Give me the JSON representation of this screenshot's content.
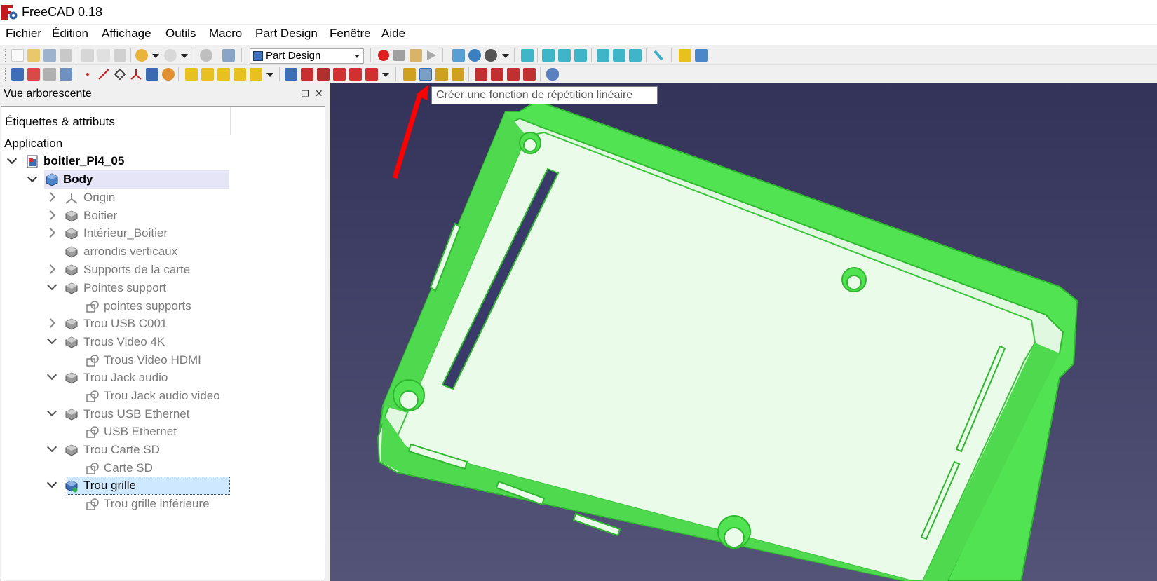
{
  "window": {
    "title": "FreeCAD 0.18"
  },
  "menu": [
    "Fichier",
    "Édition",
    "Affichage",
    "Outils",
    "Macro",
    "Part Design",
    "Fenêtre",
    "Aide"
  ],
  "workbench": {
    "selected": "Part Design"
  },
  "tooltip": "Créer une fonction de répétition linéaire",
  "panel": {
    "title": "Vue arborescente",
    "column_header": "Étiquettes & attributs",
    "root_label": "Application"
  },
  "tree": {
    "document": "boitier_Pi4_05",
    "body": "Body",
    "items": [
      "Origin",
      "Boitier",
      "Intérieur_Boitier",
      "arrondis verticaux",
      "Supports de la carte",
      "Pointes support",
      "pointes supports",
      "Trou USB C001",
      "Trous Video 4K",
      "Trous Video HDMI",
      "Trou Jack audio",
      "Trou Jack audio video",
      "Trous USB Ethernet",
      "USB Ethernet",
      "Trou Carte SD",
      "Carte SD",
      "Trou grille",
      "Trou grille inférieure"
    ]
  },
  "colors": {
    "model_green": "#52e352",
    "model_face": "#eafbea",
    "viewport_top": "#33335a",
    "viewport_bottom": "#545478",
    "selection": "#cde8ff",
    "arrow": "#ff0000"
  },
  "icons": [
    "freecad-logo-icon",
    "new-file-icon",
    "open-icon",
    "save-icon",
    "print-icon",
    "cut-icon",
    "copy-icon",
    "paste-icon",
    "undo-icon",
    "redo-icon",
    "refresh-icon",
    "whats-this-icon",
    "record-macro-icon",
    "stop-macro-icon",
    "edit-macro-icon",
    "run-macro-icon",
    "fit-all-icon",
    "fit-selection-icon",
    "draw-style-icon",
    "isometric-view-icon",
    "measure-icon",
    "part-icon",
    "group-icon",
    "linear-pattern-icon"
  ]
}
